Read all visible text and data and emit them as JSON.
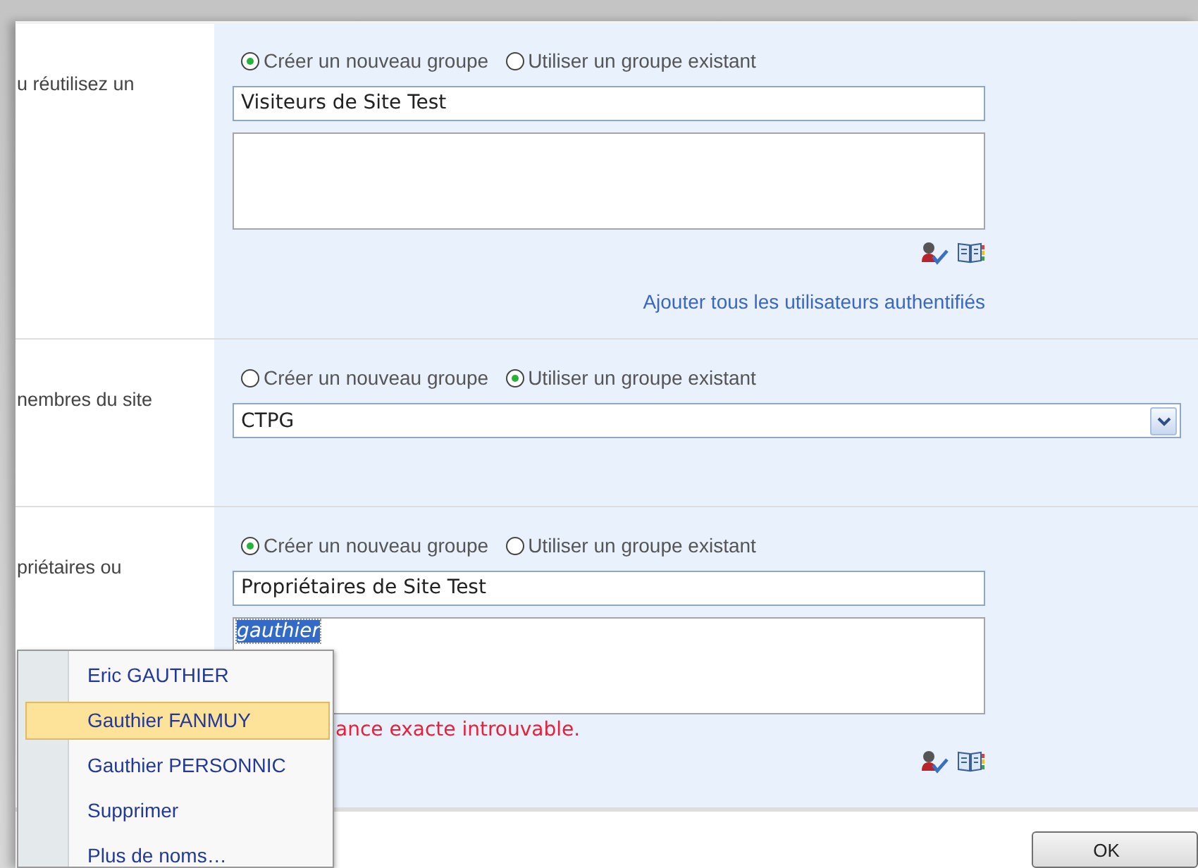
{
  "sections": [
    {
      "label": "u réutilisez un",
      "kind": "create",
      "options": [
        {
          "label": "Créer un nouveau groupe",
          "selected": true
        },
        {
          "label": "Utiliser un groupe existant",
          "selected": false
        }
      ],
      "group_name": "Visiteurs de Site Test",
      "link": "Ajouter tous les utilisateurs authentifiés"
    },
    {
      "label": "nembres du site",
      "kind": "select",
      "options": [
        {
          "label": "Créer un nouveau groupe",
          "selected": false
        },
        {
          "label": "Utiliser un groupe existant",
          "selected": true
        }
      ],
      "group_select": "CTPG"
    },
    {
      "label": "priétaires ou",
      "kind": "create",
      "options": [
        {
          "label": "Créer un nouveau groupe",
          "selected": true
        },
        {
          "label": "Utiliser un groupe existant",
          "selected": false
        }
      ],
      "group_name": "Propriétaires de Site Test",
      "members": {
        "value": "gauthier",
        "selected": true
      },
      "error": "ance exacte introuvable."
    }
  ],
  "popup_menu": {
    "names": [
      {
        "label": "Eric GAUTHIER",
        "selected": false
      },
      {
        "label": "Gauthier FANMUY",
        "selected": true
      },
      {
        "label": "Gauthier PERSONNIC",
        "selected": false
      }
    ],
    "actions": [
      {
        "label": "Supprimer",
        "selected": false
      },
      {
        "label": "Plus de noms…",
        "selected": false
      }
    ]
  },
  "buttons": [
    {
      "label": "OK"
    }
  ]
}
